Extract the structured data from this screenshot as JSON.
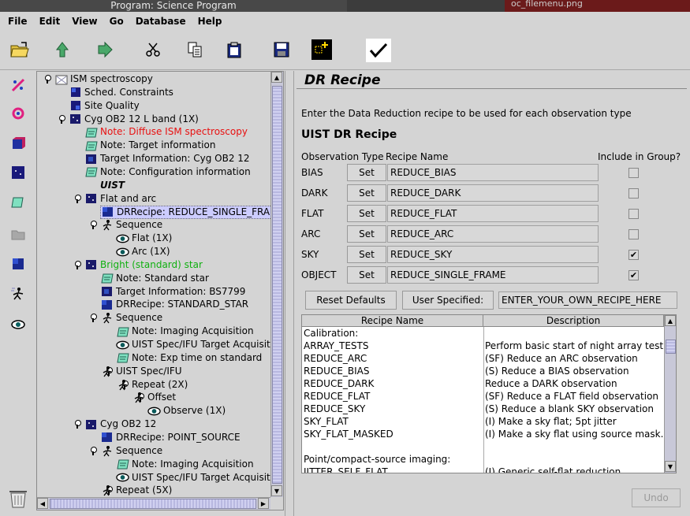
{
  "window": {
    "title": "Program: Science Program",
    "background_tab_text": "oc_filemenu.png"
  },
  "menu": [
    "File",
    "Edit",
    "View",
    "Go",
    "Database",
    "Help"
  ],
  "toolbar_icons": [
    "open-folder-icon",
    "upload-icon",
    "forward-icon",
    "cut-icon",
    "copy-icon",
    "paste-icon",
    "save-icon",
    "component-icon",
    "checkmark-icon"
  ],
  "palette_icons": [
    "telescope-icon",
    "target-icon",
    "cube-icon",
    "observation-icon",
    "note-icon",
    "folder-icon",
    "recipe-icon",
    "sequence-icon",
    "eye-icon",
    "trash-icon"
  ],
  "tree": [
    {
      "label": "ISM spectroscopy",
      "icon": "program-icon",
      "style": ""
    },
    {
      "label": "Sched. Constraints",
      "icon": "constraints-icon",
      "style": ""
    },
    {
      "label": "Site Quality",
      "icon": "site-icon",
      "style": ""
    },
    {
      "label": "Cyg OB2 12 L band (1X)",
      "icon": "observation-icon",
      "style": ""
    },
    {
      "label": "Note: Diffuse ISM spectroscopy",
      "icon": "note-icon",
      "style": "red"
    },
    {
      "label": "Note: Target information",
      "icon": "note-icon",
      "style": ""
    },
    {
      "label": "Target Information: Cyg OB2 12",
      "icon": "target-icon",
      "style": ""
    },
    {
      "label": "Note: Configuration information",
      "icon": "note-icon",
      "style": ""
    },
    {
      "label": "UIST",
      "icon": "instrument-icon",
      "style": "ital"
    },
    {
      "label": "Flat and arc",
      "icon": "observation-icon",
      "style": ""
    },
    {
      "label": "DRRecipe: REDUCE_SINGLE_FRAM",
      "icon": "recipe-icon",
      "style": "sel"
    },
    {
      "label": "Sequence",
      "icon": "sequence-icon",
      "style": ""
    },
    {
      "label": "Flat (1X)",
      "icon": "eye-icon",
      "style": ""
    },
    {
      "label": "Arc (1X)",
      "icon": "eye-icon",
      "style": ""
    },
    {
      "label": "Bright (standard) star",
      "icon": "observation-icon",
      "style": "green"
    },
    {
      "label": "Note: Standard star",
      "icon": "note-icon",
      "style": ""
    },
    {
      "label": "Target Information: BS7799",
      "icon": "target-icon",
      "style": ""
    },
    {
      "label": "DRRecipe: STANDARD_STAR",
      "icon": "recipe-icon",
      "style": ""
    },
    {
      "label": "Sequence",
      "icon": "sequence-icon",
      "style": ""
    },
    {
      "label": "Note: Imaging Acquisition",
      "icon": "note-icon",
      "style": ""
    },
    {
      "label": "UIST Spec/IFU Target Acquisiti",
      "icon": "eye-icon",
      "style": ""
    },
    {
      "label": "Note: Exp time on standard",
      "icon": "note-icon",
      "style": ""
    },
    {
      "label": "UIST Spec/IFU",
      "icon": "sequence-icon",
      "style": ""
    },
    {
      "label": "Repeat (2X)",
      "icon": "sequence-icon",
      "style": ""
    },
    {
      "label": "Offset",
      "icon": "sequence-icon",
      "style": ""
    },
    {
      "label": "Observe (1X)",
      "icon": "eye-icon",
      "style": ""
    },
    {
      "label": "Cyg OB2 12",
      "icon": "observation-icon",
      "style": ""
    },
    {
      "label": "DRRecipe: POINT_SOURCE",
      "icon": "recipe-icon",
      "style": ""
    },
    {
      "label": "Sequence",
      "icon": "sequence-icon",
      "style": ""
    },
    {
      "label": "Note: Imaging Acquisition",
      "icon": "note-icon",
      "style": ""
    },
    {
      "label": "UIST Spec/IFU Target Acquisiti",
      "icon": "eye-icon",
      "style": ""
    },
    {
      "label": "Repeat (5X)",
      "icon": "sequence-icon",
      "style": ""
    }
  ],
  "panel": {
    "heading": "DR Recipe",
    "intro": "Enter the Data Reduction recipe to be used for each observation type",
    "section": "UIST DR Recipe",
    "col_obs_type": "Observation Type",
    "col_recipe": "Recipe Name",
    "col_include": "Include in Group?",
    "rows": [
      {
        "type": "BIAS",
        "set": "Set",
        "recipe": "REDUCE_BIAS",
        "include": ""
      },
      {
        "type": "DARK",
        "set": "Set",
        "recipe": "REDUCE_DARK",
        "include": ""
      },
      {
        "type": "FLAT",
        "set": "Set",
        "recipe": "REDUCE_FLAT",
        "include": ""
      },
      {
        "type": "ARC",
        "set": "Set",
        "recipe": "REDUCE_ARC",
        "include": ""
      },
      {
        "type": "SKY",
        "set": "Set",
        "recipe": "REDUCE_SKY",
        "include": "✔"
      },
      {
        "type": "OBJECT",
        "set": "Set",
        "recipe": "REDUCE_SINGLE_FRAME",
        "include": "✔"
      }
    ],
    "reset_defaults": "Reset Defaults",
    "user_specified": "User Specified:",
    "own_recipe": "ENTER_YOUR_OWN_RECIPE_HERE",
    "table": {
      "headers": [
        "Recipe Name",
        "Description"
      ],
      "rows": [
        [
          "Calibration:",
          ""
        ],
        [
          "ARRAY_TESTS",
          "Perform basic start of night array tests"
        ],
        [
          "REDUCE_ARC",
          "(SF) Reduce an ARC observation"
        ],
        [
          "REDUCE_BIAS",
          "(S) Reduce a BIAS observation"
        ],
        [
          "REDUCE_DARK",
          "Reduce a DARK observation"
        ],
        [
          "REDUCE_FLAT",
          "(SF) Reduce a FLAT field observation"
        ],
        [
          "REDUCE_SKY",
          "(S) Reduce a blank SKY observation"
        ],
        [
          "SKY_FLAT",
          "(I) Make a sky flat; 5pt jitter"
        ],
        [
          "SKY_FLAT_MASKED",
          "(I) Make a sky flat using source mask..."
        ],
        [
          "",
          ""
        ],
        [
          "Point/compact-source imaging:",
          ""
        ],
        [
          "JITTER_SELF_FLAT",
          "(I) Generic self-flat reduction"
        ]
      ]
    },
    "undo": "Undo"
  }
}
